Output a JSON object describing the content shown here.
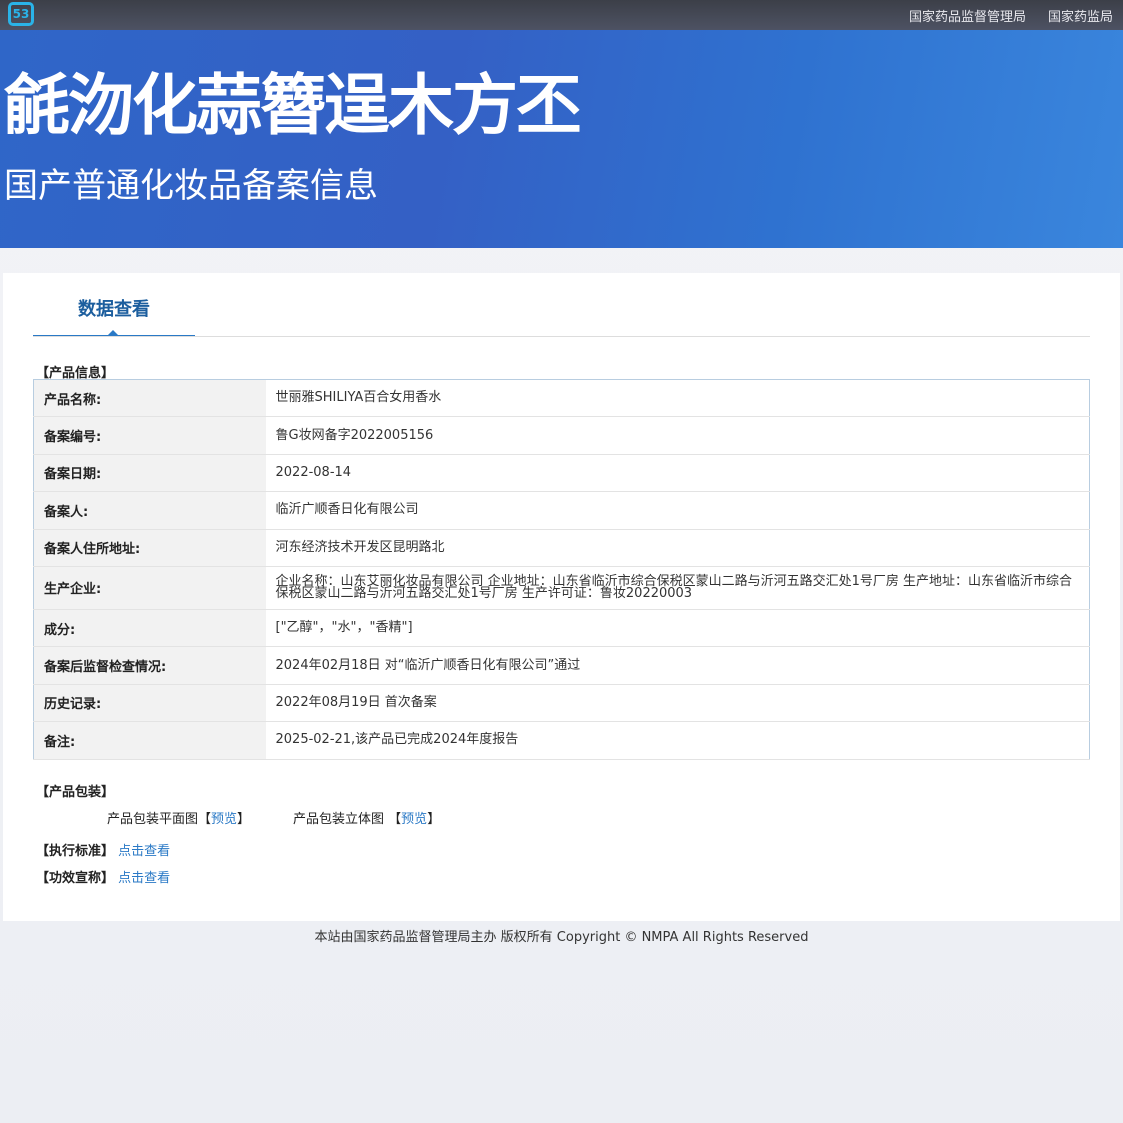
{
  "header": {
    "logo_text": "53",
    "top_links": [
      "国家药品监督管理局",
      "国家药监局"
    ],
    "logo_title": "毹沕化蒜簪逞木方丕",
    "subtitle": "国产普通化妆品备案信息"
  },
  "tab": "数据查看",
  "product_info": {
    "title": "【产品信息】",
    "rows": [
      {
        "label": "产品名称:",
        "value": "世丽雅SHILIYA百合女用香水"
      },
      {
        "label": "备案编号:",
        "value": "鲁G妆网备字2022005156"
      },
      {
        "label": "备案日期:",
        "value": "2022-08-14"
      },
      {
        "label": "备案人:",
        "value": "临沂广顺香日化有限公司"
      },
      {
        "label": "备案人住所地址:",
        "value": "河东经济技术开发区昆明路北"
      },
      {
        "label": "生产企业:",
        "value": "企业名称：山东艾丽化妆品有限公司 企业地址：山东省临沂市综合保税区蒙山二路与沂河五路交汇处1号厂房 生产地址：山东省临沂市综合保税区蒙山二路与沂河五路交汇处1号厂房 生产许可证：鲁妆20220003"
      },
      {
        "label": "成分:",
        "value": "[\"乙醇\"，\"水\"，\"香精\"]"
      },
      {
        "label": "备案后监督检查情况:",
        "value": "2024年02月18日 对“临沂广顺香日化有限公司”通过"
      },
      {
        "label": "历史记录:",
        "value": "2022年08月19日 首次备案"
      },
      {
        "label": "备注:",
        "value": "2025-02-21,该产品已完成2024年度报告"
      }
    ]
  },
  "packaging": {
    "title": "【产品包装】",
    "flat_label": "产品包装平面图",
    "solid_label": "产品包装立体图",
    "preview": "预览",
    "lb": "【",
    "rb": "】"
  },
  "standard": {
    "title": "【执行标准】",
    "link": "点击查看"
  },
  "efficacy": {
    "title": "【功效宣称】",
    "link": "点击查看"
  },
  "footer": "本站由国家药品监督管理局主办 版权所有 Copyright © NMPA All Rights Reserved"
}
